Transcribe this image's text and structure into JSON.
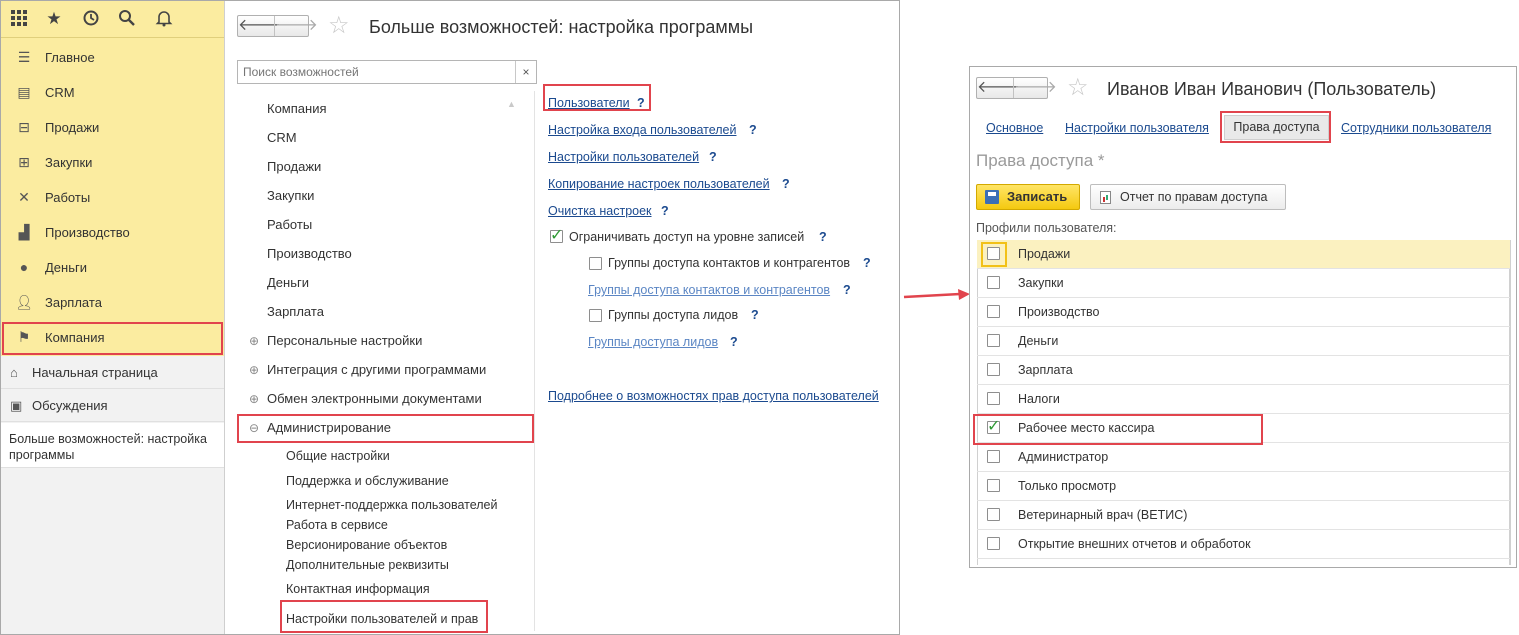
{
  "sidebar": {
    "sections": [
      {
        "label": "Главное"
      },
      {
        "label": "CRM"
      },
      {
        "label": "Продажи"
      },
      {
        "label": "Закупки"
      },
      {
        "label": "Работы"
      },
      {
        "label": "Производство"
      },
      {
        "label": "Деньги"
      },
      {
        "label": "Зарплата"
      },
      {
        "label": "Компания"
      }
    ],
    "home_label": "Начальная страница",
    "discussions_label": "Обсуждения",
    "current_page": "Больше возможностей: настройка программы"
  },
  "main_window": {
    "title": "Больше возможностей: настройка программы",
    "search_placeholder": "Поиск возможностей",
    "search_clear": "×",
    "tree": [
      {
        "label": "Компания"
      },
      {
        "label": "CRM"
      },
      {
        "label": "Продажи"
      },
      {
        "label": "Закупки"
      },
      {
        "label": "Работы"
      },
      {
        "label": "Производство"
      },
      {
        "label": "Деньги"
      },
      {
        "label": "Зарплата"
      },
      {
        "label": "Персональные настройки"
      },
      {
        "label": "Интеграция с другими программами"
      },
      {
        "label": "Обмен электронными документами"
      },
      {
        "label": "Администрирование"
      }
    ],
    "expand_collapsed": "⊕",
    "expand_open": "⊖",
    "admin_children": [
      "Общие настройки",
      "Поддержка и обслуживание",
      "Интернет-поддержка пользователей",
      "Работа в сервисе",
      "Версионирование объектов",
      "Дополнительные реквизиты",
      "Контактная информация",
      "Настройки пользователей и прав"
    ],
    "links": [
      "Пользователи",
      "Настройка входа пользователей",
      "Настройки пользователей",
      "Копирование настроек пользователей",
      "Очистка настроек"
    ],
    "help_mark": "?",
    "restrict_checkbox": "Ограничивать доступ на уровне записей",
    "contact_groups_checkbox": "Группы доступа контактов и контрагентов",
    "contact_groups_link": "Группы доступа контактов и контрагентов",
    "lead_groups_checkbox": "Группы доступа лидов",
    "lead_groups_link": "Группы доступа лидов",
    "more_link": "Подробнее о возможностях прав доступа пользователей"
  },
  "user_window": {
    "title": "Иванов Иван Иванович (Пользователь)",
    "tabs": [
      "Основное",
      "Настройки пользователя",
      "Права доступа",
      "Сотрудники пользователя"
    ],
    "section_title": "Права доступа *",
    "save_button": "Записать",
    "report_button": "Отчет по правам доступа",
    "profiles_label": "Профили пользователя:",
    "profiles": [
      {
        "label": "Продажи",
        "checked": false
      },
      {
        "label": "Закупки",
        "checked": false
      },
      {
        "label": "Производство",
        "checked": false
      },
      {
        "label": "Деньги",
        "checked": false
      },
      {
        "label": "Зарплата",
        "checked": false
      },
      {
        "label": "Налоги",
        "checked": false
      },
      {
        "label": "Рабочее место кассира",
        "checked": true
      },
      {
        "label": "Администратор",
        "checked": false
      },
      {
        "label": "Только просмотр",
        "checked": false
      },
      {
        "label": "Ветеринарный врач (ВЕТИС)",
        "checked": false
      },
      {
        "label": "Открытие внешних отчетов и обработок",
        "checked": false
      }
    ]
  },
  "colors": {
    "sidebar_yellow": "#fbeca0",
    "highlight_red": "#e1444d",
    "link_blue": "#1b4a8f",
    "check_green": "#2f9a35",
    "save_yellow": "#f4c910"
  }
}
